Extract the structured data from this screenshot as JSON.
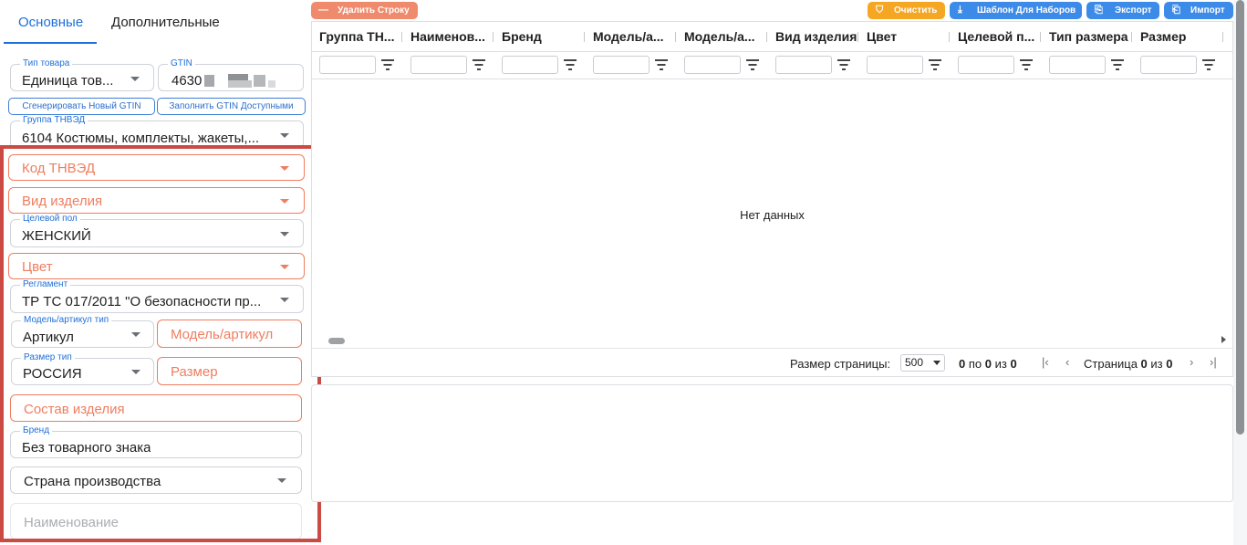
{
  "tabs": [
    {
      "label": "Основные",
      "active": true
    },
    {
      "label": "Дополнительные",
      "active": false
    }
  ],
  "form": {
    "product_type": {
      "label": "Тип товара",
      "value": "Единица тов..."
    },
    "gtin": {
      "label": "GTIN",
      "value": "4630"
    },
    "gen_gtin_button": "Сгенерировать Новый GTIN",
    "fill_gtin_button": "Заполнить GTIN Доступными",
    "tnved_group": {
      "label": "Группа ТНВЭД",
      "value": "6104 Костюмы, комплекты, жакеты,..."
    },
    "tnved_code": {
      "placeholder": "Код ТНВЭД"
    },
    "item_kind": {
      "placeholder": "Вид изделия"
    },
    "target_gender": {
      "label": "Целевой пол",
      "value": "ЖЕНСКИЙ"
    },
    "color": {
      "placeholder": "Цвет"
    },
    "regulation": {
      "label": "Регламент",
      "value": "ТР ТС 017/2011 \"О безопасности пр..."
    },
    "model_type": {
      "label": "Модель/артикул тип",
      "value": "Артикул"
    },
    "model_article": {
      "placeholder": "Модель/артикул"
    },
    "size_type": {
      "label": "Размер тип",
      "value": "РОССИЯ"
    },
    "size": {
      "placeholder": "Размер"
    },
    "composition": {
      "placeholder": "Состав изделия"
    },
    "brand": {
      "label": "Бренд",
      "value": "Без товарного знака"
    },
    "country": {
      "placeholder": "Страна производства"
    },
    "name": {
      "placeholder": "Наименование"
    }
  },
  "toolbar": {
    "delete_row": "Удалить Строку",
    "clear": "Очистить",
    "template": "Шаблон Для Наборов",
    "export": "Экспорт",
    "import": "Импорт"
  },
  "grid": {
    "columns": [
      "Группа ТН...",
      "Наименов...",
      "Бренд",
      "Модель/а...",
      "Модель/а...",
      "Вид изделия",
      "Цвет",
      "Целевой п...",
      "Тип размера",
      "Размер"
    ],
    "no_data": "Нет данных"
  },
  "pager": {
    "page_size_label": "Размер страницы:",
    "page_size": "500",
    "range_from": "0",
    "range_to_word": "по",
    "range_to": "0",
    "of_word": "из",
    "total": "0",
    "page_word": "Страница",
    "page": "0",
    "page_of_word": "из",
    "page_total": "0"
  },
  "colors": {
    "accent": "#1e6fd9",
    "error": "#ef7d5f",
    "delete_button": "#f08a6d",
    "clear_button": "#f5a623",
    "blue_button": "#3d8be8",
    "highlight_box": "#cc4a44"
  }
}
